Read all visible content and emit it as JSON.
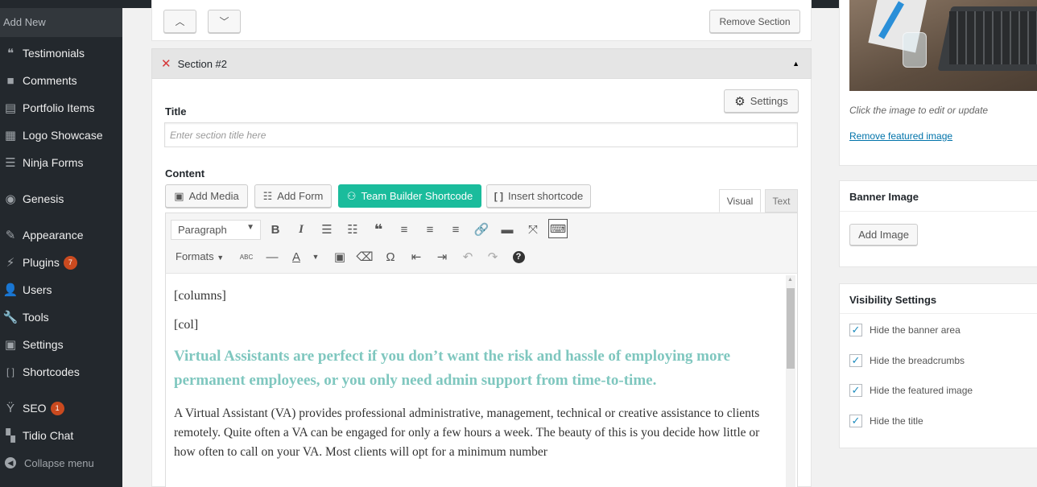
{
  "sidebar": {
    "add_new": "Add New",
    "items": [
      {
        "label": "Testimonials",
        "icon": "quote-icon",
        "glyph": "❝"
      },
      {
        "label": "Comments",
        "icon": "comment-icon",
        "glyph": "■"
      },
      {
        "label": "Portfolio Items",
        "icon": "portfolio-icon",
        "glyph": "▤"
      },
      {
        "label": "Logo Showcase",
        "icon": "images-icon",
        "glyph": "▦"
      },
      {
        "label": "Ninja Forms",
        "icon": "forms-icon",
        "glyph": "☰"
      },
      {
        "label": "Genesis",
        "icon": "genesis-icon",
        "glyph": "◉"
      },
      {
        "label": "Appearance",
        "icon": "paintbrush-icon",
        "glyph": "✎"
      },
      {
        "label": "Plugins",
        "icon": "plugin-icon",
        "glyph": "⚡",
        "badge": "7"
      },
      {
        "label": "Users",
        "icon": "users-icon",
        "glyph": "👤"
      },
      {
        "label": "Tools",
        "icon": "wrench-icon",
        "glyph": "🔧"
      },
      {
        "label": "Settings",
        "icon": "settings-icon",
        "glyph": "▣"
      },
      {
        "label": "Shortcodes",
        "icon": "brackets-icon",
        "glyph": "[ ]"
      },
      {
        "label": "SEO",
        "icon": "yoast-icon",
        "glyph": "Ÿ",
        "badge": "1"
      },
      {
        "label": "Tidio Chat",
        "icon": "chat-icon",
        "glyph": "▚"
      }
    ],
    "collapse": "Collapse menu"
  },
  "section_top": {
    "up_glyph": "︿",
    "down_glyph": "﹀",
    "remove_label": "Remove Section"
  },
  "section": {
    "title": "Section #2",
    "settings_label": "Settings",
    "title_label": "Title",
    "title_placeholder": "Enter section title here",
    "content_label": "Content",
    "media_buttons": {
      "add_media": "Add Media",
      "add_form": "Add Form",
      "team_builder": "Team Builder Shortcode",
      "insert_shortcode": "Insert shortcode"
    },
    "tabs": {
      "visual": "Visual",
      "text": "Text"
    },
    "toolbar": {
      "format_value": "Paragraph",
      "formats_label": "Formats"
    },
    "editor": {
      "line1": "[columns]",
      "line2": "[col]",
      "heading": "Virtual Assistants are perfect if you don’t want the risk and hassle of employing more permanent employees, or you only need admin support from time-to-time.",
      "body": "A Virtual Assistant (VA) provides professional administrative, management, technical or creative assistance to clients remotely. Quite often a VA can be engaged for only a few hours a week. The beauty of this is you decide how little or how often to call on your VA. Most clients will opt for a minimum number"
    }
  },
  "right": {
    "featured": {
      "hint": "Click the image to edit or update",
      "remove_link": "Remove featured image"
    },
    "banner": {
      "title": "Banner Image",
      "add_button": "Add Image"
    },
    "visibility": {
      "title": "Visibility Settings",
      "options": [
        {
          "label": "Hide the banner area",
          "checked": true
        },
        {
          "label": "Hide the breadcrumbs",
          "checked": true
        },
        {
          "label": "Hide the featured image",
          "checked": true
        },
        {
          "label": "Hide the title",
          "checked": true
        }
      ]
    }
  },
  "colors": {
    "accent": "#1abc9c",
    "sidebar_bg": "#23282d",
    "heading_teal": "#7fc7bf",
    "link": "#0073aa"
  }
}
